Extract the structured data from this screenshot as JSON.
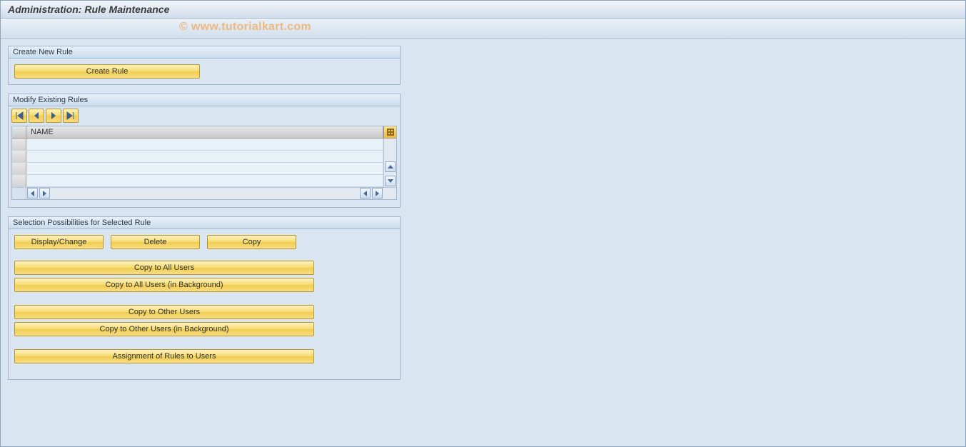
{
  "title": "Administration: Rule Maintenance",
  "watermark": "© www.tutorialkart.com",
  "panels": {
    "create": {
      "title": "Create New Rule",
      "button": "Create Rule"
    },
    "modify": {
      "title": "Modify Existing Rules",
      "column_header": "NAME",
      "toolbar_icons": [
        "first-page-icon",
        "previous-page-icon",
        "next-page-icon",
        "last-page-icon"
      ],
      "rows": [
        "",
        "",
        "",
        ""
      ]
    },
    "selection": {
      "title": "Selection Possibilities for Selected Rule",
      "buttons_row": [
        "Display/Change",
        "Delete",
        "Copy"
      ],
      "buttons_block1": [
        "Copy to All Users",
        "Copy to All Users (in Background)"
      ],
      "buttons_block2": [
        "Copy to Other Users",
        "Copy to Other Users (in Background)"
      ],
      "buttons_block3": [
        "Assignment of Rules to Users"
      ]
    }
  }
}
